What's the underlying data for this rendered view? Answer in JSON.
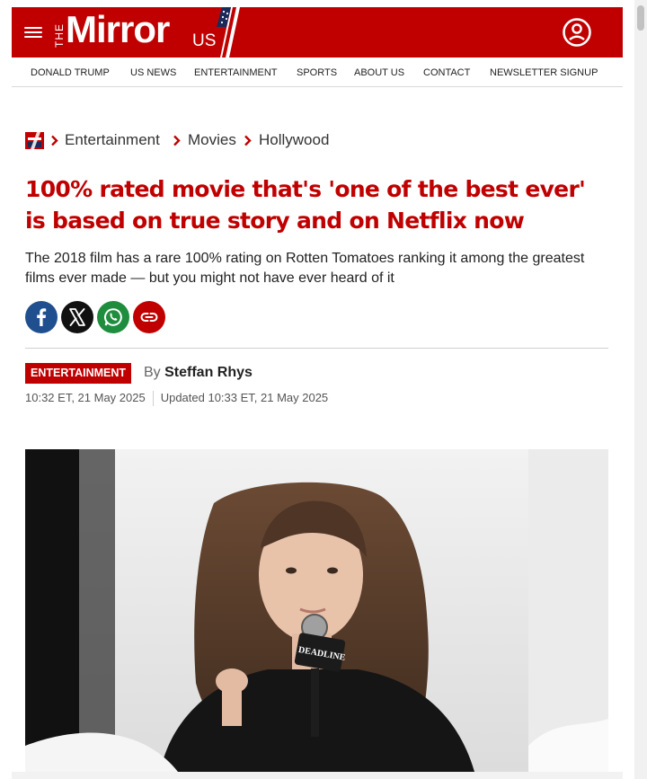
{
  "site": {
    "logo_prefix": "THE",
    "logo_word": "Mirror",
    "logo_suffix": "US",
    "brand_color": "#c00000"
  },
  "nav": {
    "items": [
      "DONALD TRUMP",
      "US NEWS",
      "ENTERTAINMENT",
      "SPORTS",
      "ABOUT US",
      "CONTACT",
      "NEWSLETTER SIGNUP"
    ]
  },
  "breadcrumb": {
    "items": [
      "Entertainment",
      "Movies",
      "Hollywood"
    ]
  },
  "article": {
    "headline": "100% rated movie that's 'one of the best ever' is based on true story and on Netflix now",
    "standfirst": "The 2018 film has a rare 100% rating on Rotten Tomatoes ranking it among the greatest films ever made — but you might not have ever heard of it",
    "section": "ENTERTAINMENT",
    "byline_prefix": "By",
    "author": "Steffan Rhys",
    "published": "10:32 ET, 21 May 2025",
    "updated": "Updated 10:33 ET, 21 May 2025",
    "image_mic_label": "DEADLINE"
  },
  "share": {
    "icons": [
      "facebook-icon",
      "x-icon",
      "whatsapp-icon",
      "link-icon"
    ]
  }
}
